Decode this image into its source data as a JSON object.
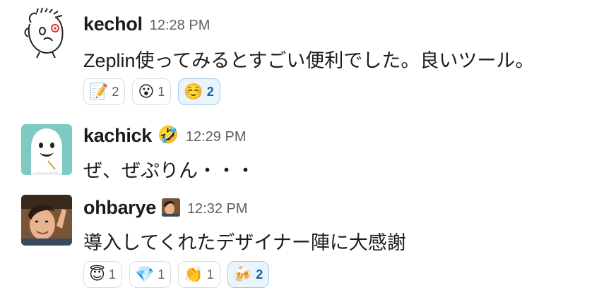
{
  "messages": [
    {
      "username": "kechol",
      "time": "12:28 PM",
      "text": "Zeplin使ってみるとすごい便利でした。良いツール。",
      "avatar": "sketch-face-avatar",
      "reactions": [
        {
          "emoji": "📝",
          "count": "2",
          "active": false
        },
        {
          "emoji": "😮",
          "count": "1",
          "active": false
        },
        {
          "emoji": "☺️",
          "count": "2",
          "active": true
        }
      ]
    },
    {
      "username": "kachick",
      "status_emoji": "🤣",
      "time": "12:29 PM",
      "text": "ぜ、ぜぷりん・・・",
      "avatar": "ghost-avatar",
      "reactions": []
    },
    {
      "username": "ohbarye",
      "status_icon": "photo-status-icon",
      "time": "12:32 PM",
      "text": "導入してくれたデザイナー陣に大感謝",
      "avatar": "photo-avatar",
      "reactions": [
        {
          "emoji": "😇",
          "count": "1",
          "active": false
        },
        {
          "emoji": "💎",
          "count": "1",
          "active": false
        },
        {
          "emoji": "👏",
          "count": "1",
          "active": false
        },
        {
          "emoji": "🍻",
          "count": "2",
          "active": true
        }
      ]
    }
  ],
  "colors": {
    "text": "#1d1c1d",
    "timestamp": "#616061",
    "reaction_border": "#dddddd",
    "reaction_active_bg": "#eaf4fb",
    "reaction_active_border": "#a6cce8",
    "reaction_active_count": "#1264a3",
    "ghost_bg": "#7fc9c3"
  }
}
